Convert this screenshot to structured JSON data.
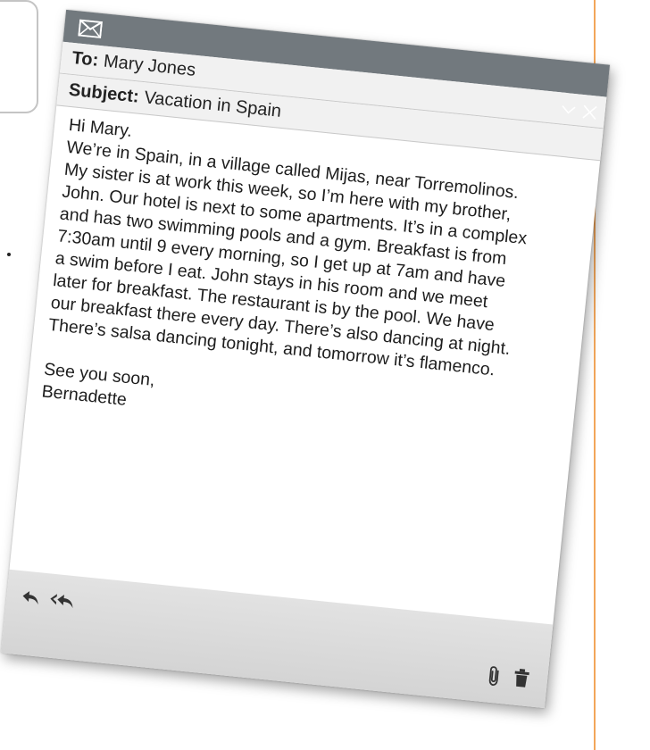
{
  "email": {
    "to_label": "To:",
    "to_value": "Mary Jones",
    "subject_label": "Subject:",
    "subject_value": "Vacation in Spain",
    "greeting": "Hi Mary.",
    "body_lines": [
      "We’re in Spain, in a village called Mijas, near Torremolinos.",
      "My sister is at work this week, so I’m here with my brother,",
      "John. Our hotel is next to some apartments. It’s in a complex",
      "and has two swimming pools and a gym. Breakfast is from",
      "7:30am until 9 every morning, so I get up at 7am and have",
      "a swim before I eat. John stays in his room and we meet",
      "later for breakfast. The restaurant is by the pool. We have",
      "our breakfast there every day. There’s also dancing at night.",
      "There’s salsa dancing tonight, and tomorrow it’s flamenco."
    ],
    "sign_off": "See you soon,",
    "signature": "Bernadette"
  },
  "icons": {
    "titlebar": "envelope-icon",
    "window": [
      "chevron-down-icon",
      "close-icon"
    ],
    "footer_left": [
      "reply-icon",
      "reply-all-icon"
    ],
    "footer_right": [
      "paperclip-icon",
      "trash-icon"
    ]
  },
  "colors": {
    "titlebar": "#72797e",
    "header_rows": "#f1f1f1",
    "footer": "#d9d9d9",
    "accent_line": "#f2a65a"
  }
}
